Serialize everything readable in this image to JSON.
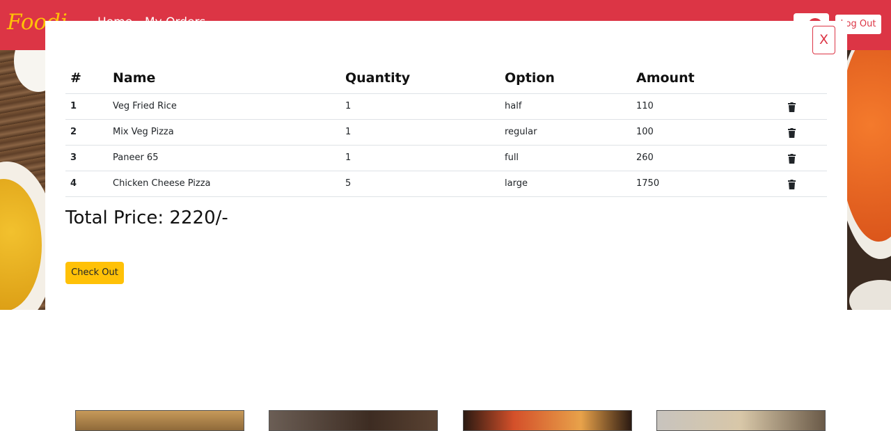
{
  "navbar": {
    "brand": "Foodi",
    "home": "Home",
    "orders": "My Orders",
    "logout_label": "Log Out"
  },
  "modal": {
    "close_label": "X",
    "table": {
      "headers": [
        "#",
        "Name",
        "Quantity",
        "Option",
        "Amount"
      ],
      "rows": [
        {
          "no": "1",
          "name": "Veg Fried Rice",
          "qty": "1",
          "option": "half",
          "amount": "110"
        },
        {
          "no": "2",
          "name": "Mix Veg Pizza",
          "qty": "1",
          "option": "regular",
          "amount": "100"
        },
        {
          "no": "3",
          "name": "Paneer 65",
          "qty": "1",
          "option": "full",
          "amount": "260"
        },
        {
          "no": "4",
          "name": "Chicken Cheese Pizza",
          "qty": "5",
          "option": "large",
          "amount": "1750"
        }
      ]
    },
    "total_label": "Total Price: 2220/-",
    "checkout_label": "Check Out"
  },
  "theme": {
    "primary": "#dc3545",
    "accent": "#ffc107"
  }
}
